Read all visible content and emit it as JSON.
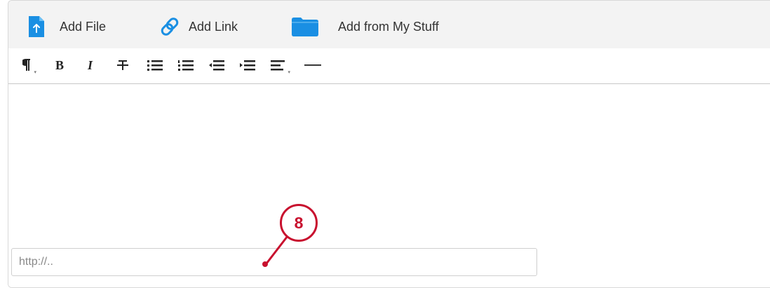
{
  "attachments": {
    "add_file": "Add File",
    "add_link": "Add Link",
    "add_from_my_stuff": "Add from My Stuff"
  },
  "toolbar": {
    "buttons": [
      {
        "name": "paragraph-format",
        "icon": "pilcrow-icon"
      },
      {
        "name": "bold",
        "icon": "bold-icon"
      },
      {
        "name": "italic",
        "icon": "italic-icon"
      },
      {
        "name": "strikethrough",
        "icon": "strikethrough-icon"
      },
      {
        "name": "bullet-list",
        "icon": "bullet-list-icon"
      },
      {
        "name": "numbered-list",
        "icon": "numbered-list-icon"
      },
      {
        "name": "outdent",
        "icon": "outdent-icon"
      },
      {
        "name": "indent",
        "icon": "indent-icon"
      },
      {
        "name": "align",
        "icon": "align-left-icon"
      },
      {
        "name": "horizontal-rule",
        "icon": "horizontal-rule-icon"
      }
    ]
  },
  "link_input": {
    "placeholder": "http://..",
    "value": ""
  },
  "callout": {
    "number": "8",
    "color": "#c8102e"
  },
  "colors": {
    "accent_blue": "#1a8fe3",
    "toolbar_bg": "#f3f3f3"
  }
}
